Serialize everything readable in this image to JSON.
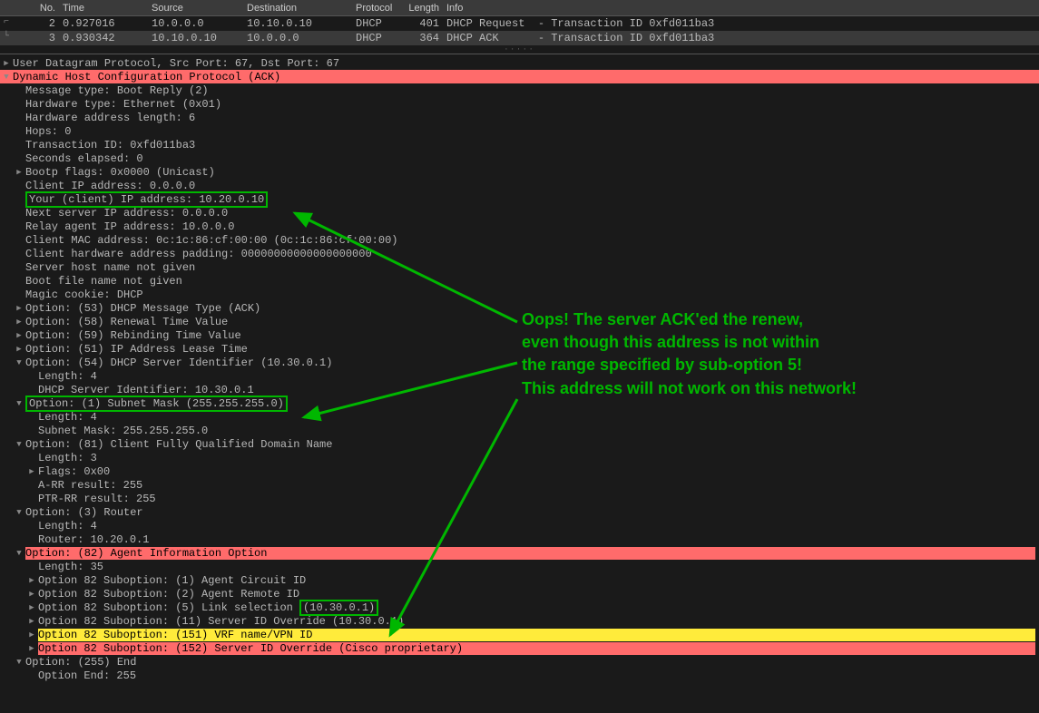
{
  "headers": {
    "no": "No.",
    "time": "Time",
    "src": "Source",
    "dst": "Destination",
    "proto": "Protocol",
    "len": "Length",
    "info": "Info"
  },
  "packets": [
    {
      "no": "2",
      "time": "0.927016",
      "src": "10.0.0.0",
      "dst": "10.10.0.10",
      "proto": "DHCP",
      "len": "401",
      "info": "DHCP Request  - Transaction ID 0xfd011ba3"
    },
    {
      "no": "3",
      "time": "0.930342",
      "src": "10.10.0.10",
      "dst": "10.0.0.0",
      "proto": "DHCP",
      "len": "364",
      "info": "DHCP ACK      - Transaction ID 0xfd011ba3"
    }
  ],
  "tree": {
    "udp": "User Datagram Protocol, Src Port: 67, Dst Port: 67",
    "dhcp_root": "Dynamic Host Configuration Protocol (ACK)",
    "msg_type": "Message type: Boot Reply (2)",
    "hw_type": "Hardware type: Ethernet (0x01)",
    "hw_len": "Hardware address length: 6",
    "hops": "Hops: 0",
    "tid": "Transaction ID: 0xfd011ba3",
    "secs": "Seconds elapsed: 0",
    "bootp": "Bootp flags: 0x0000 (Unicast)",
    "ciaddr": "Client IP address: 0.0.0.0",
    "yiaddr": "Your (client) IP address: 10.20.0.10",
    "siaddr": "Next server IP address: 0.0.0.0",
    "giaddr": "Relay agent IP address: 10.0.0.0",
    "chaddr": "Client MAC address: 0c:1c:86:cf:00:00 (0c:1c:86:cf:00:00)",
    "padding": "Client hardware address padding: 00000000000000000000",
    "sname": "Server host name not given",
    "file": "Boot file name not given",
    "cookie": "Magic cookie: DHCP",
    "opt53": "Option: (53) DHCP Message Type (ACK)",
    "opt58": "Option: (58) Renewal Time Value",
    "opt59": "Option: (59) Rebinding Time Value",
    "opt51": "Option: (51) IP Address Lease Time",
    "opt54": "Option: (54) DHCP Server Identifier (10.30.0.1)",
    "opt54_len": "Length: 4",
    "opt54_id": "DHCP Server Identifier: 10.30.0.1",
    "opt1": "Option: (1) Subnet Mask (255.255.255.0)",
    "opt1_len": "Length: 4",
    "opt1_mask": "Subnet Mask: 255.255.255.0",
    "opt81": "Option: (81) Client Fully Qualified Domain Name",
    "opt81_len": "Length: 3",
    "opt81_flags": "Flags: 0x00",
    "opt81_arr": "A-RR result: 255",
    "opt81_ptr": "PTR-RR result: 255",
    "opt3": "Option: (3) Router",
    "opt3_len": "Length: 4",
    "opt3_router": "Router: 10.20.0.1",
    "opt82": "Option: (82) Agent Information Option",
    "opt82_len": "Length: 35",
    "opt82_1": "Option 82 Suboption: (1) Agent Circuit ID",
    "opt82_2": "Option 82 Suboption: (2) Agent Remote ID",
    "opt82_5_pre": "Option 82 Suboption: (5) Link selection ",
    "opt82_5_val": "(10.30.0.1)",
    "opt82_11": "Option 82 Suboption: (11) Server ID Override (10.30.0.1)",
    "opt82_151": "Option 82 Suboption: (151) VRF name/VPN ID",
    "opt82_152": "Option 82 Suboption: (152) Server ID Override (Cisco proprietary)",
    "opt255": "Option: (255) End",
    "opt255_end": "Option End: 255"
  },
  "annotation": {
    "line1": "Oops! The server ACK'ed the renew,",
    "line2": "even though this address is not within",
    "line3": "the range specified by sub-option 5!",
    "line4": "This address will not work on this network!"
  }
}
